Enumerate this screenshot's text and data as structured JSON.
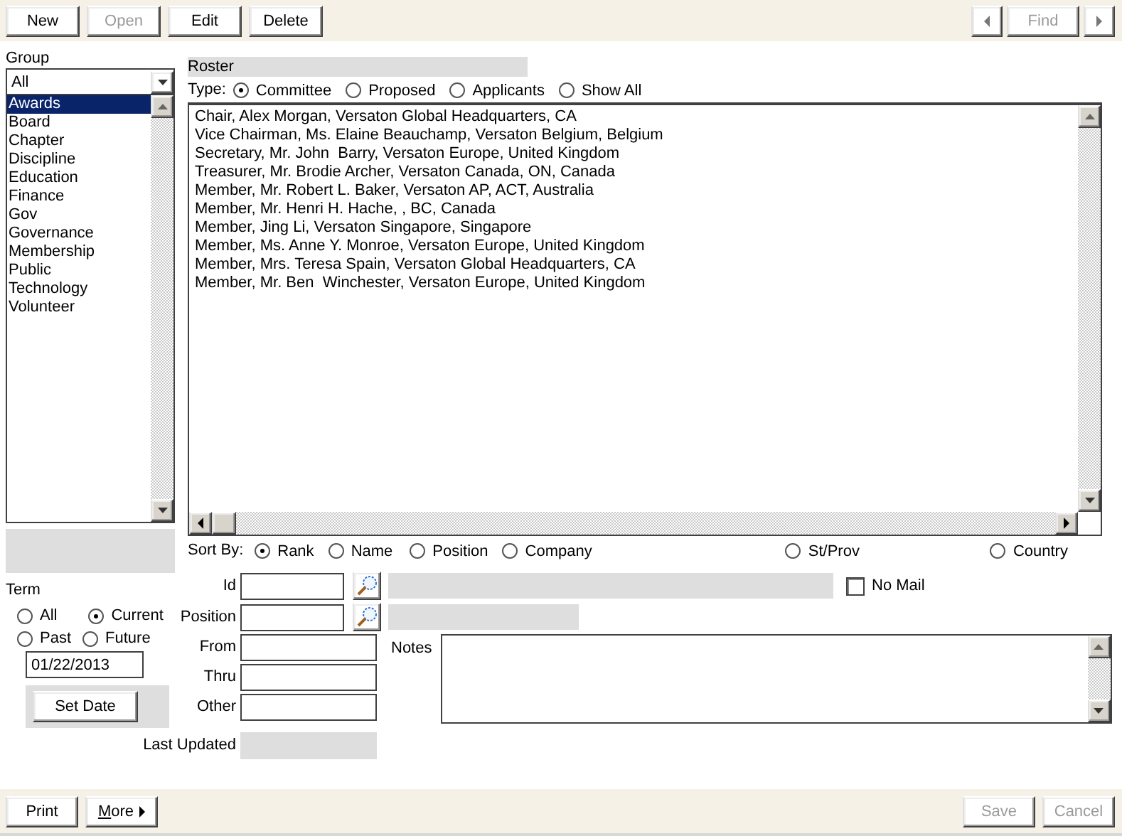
{
  "toolbar": {
    "buttons": [
      {
        "label": "New",
        "disabled": false
      },
      {
        "label": "Open",
        "disabled": true
      },
      {
        "label": "Edit",
        "disabled": false
      },
      {
        "label": "Delete",
        "disabled": false
      }
    ],
    "nav": [
      {
        "kind": "prev"
      },
      {
        "kind": "find",
        "label": "Find",
        "disabled": true
      },
      {
        "kind": "next"
      }
    ]
  },
  "group": {
    "label": "Group",
    "combo_value": "All",
    "items": [
      {
        "label": "Awards",
        "selected": true
      },
      {
        "label": "Board",
        "selected": false
      },
      {
        "label": "Chapter",
        "selected": false
      },
      {
        "label": "Discipline",
        "selected": false
      },
      {
        "label": "Education",
        "selected": false
      },
      {
        "label": "Finance",
        "selected": false
      },
      {
        "label": "Gov",
        "selected": false
      },
      {
        "label": "Governance",
        "selected": false
      },
      {
        "label": "Membership",
        "selected": false
      },
      {
        "label": "Public",
        "selected": false
      },
      {
        "label": "Technology",
        "selected": false
      },
      {
        "label": "Volunteer",
        "selected": false
      }
    ]
  },
  "roster": {
    "title": "Roster",
    "type_label": "Type:",
    "type_options": [
      {
        "label": "Committee",
        "selected": true
      },
      {
        "label": "Proposed",
        "selected": false
      },
      {
        "label": "Applicants",
        "selected": false
      },
      {
        "label": "Show All",
        "selected": false
      }
    ],
    "rows": [
      "Chair, Alex Morgan, Versaton Global Headquarters, CA",
      "Vice Chairman, Ms. Elaine Beauchamp, Versaton Belgium, Belgium",
      "Secretary, Mr. John  Barry, Versaton Europe, United Kingdom",
      "Treasurer, Mr. Brodie Archer, Versaton Canada, ON, Canada",
      "Member, Mr. Robert L. Baker, Versaton AP, ACT, Australia",
      "Member, Mr. Henri H. Hache, , BC, Canada",
      "Member, Jing Li, Versaton Singapore, Singapore",
      "Member, Ms. Anne Y. Monroe, Versaton Europe, United Kingdom",
      "Member, Mrs. Teresa Spain, Versaton Global Headquarters, CA",
      "Member, Mr. Ben  Winchester, Versaton Europe, United Kingdom"
    ],
    "sort_label": "Sort By:",
    "sort_options": [
      {
        "label": "Rank",
        "selected": true
      },
      {
        "label": "Name",
        "selected": false
      },
      {
        "label": "Position",
        "selected": false
      },
      {
        "label": "Company",
        "selected": false
      },
      {
        "label": "St/Prov",
        "selected": false
      },
      {
        "label": "Country",
        "selected": false
      }
    ]
  },
  "term": {
    "label": "Term",
    "options": [
      {
        "label": "All",
        "selected": false
      },
      {
        "label": "Current",
        "selected": true
      },
      {
        "label": "Past",
        "selected": false
      },
      {
        "label": "Future",
        "selected": false
      }
    ],
    "date": "01/22/2013",
    "set_date_button": "Set Date"
  },
  "form": {
    "fields": [
      {
        "label": "Id",
        "kind": "lookup"
      },
      {
        "label": "Position",
        "kind": "lookup"
      },
      {
        "label": "From",
        "kind": "text"
      },
      {
        "label": "Thru",
        "kind": "text"
      },
      {
        "label": "Other",
        "kind": "text"
      },
      {
        "label": "Last Updated",
        "kind": "readonly"
      }
    ],
    "no_mail": {
      "label": "No Mail",
      "checked": false
    },
    "notes_label": "Notes"
  },
  "footer": {
    "left": [
      {
        "label": "Print",
        "kind": "plain",
        "disabled": false
      },
      {
        "label": "More",
        "kind": "menu",
        "disabled": false
      }
    ],
    "right": [
      {
        "label": "Save",
        "kind": "plain",
        "disabled": true
      },
      {
        "label": "Cancel",
        "kind": "plain",
        "disabled": true
      }
    ]
  }
}
